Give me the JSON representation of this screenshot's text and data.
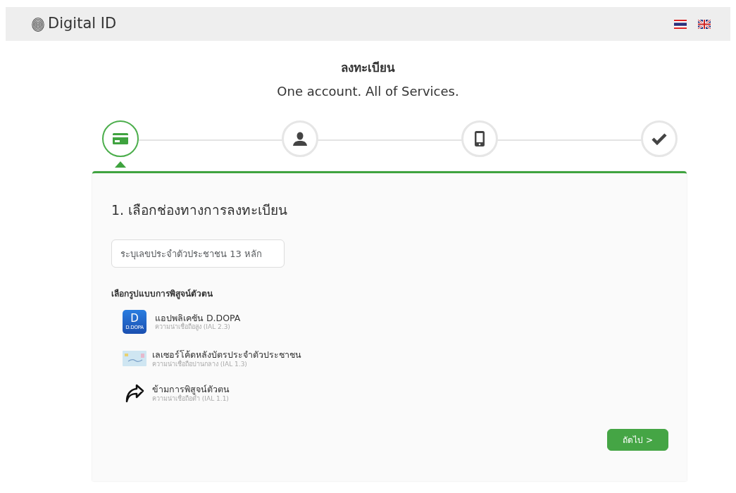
{
  "header": {
    "brand": "Digital ID",
    "languages": [
      {
        "kind": "thai"
      },
      {
        "kind": "english"
      }
    ]
  },
  "title": "ลงทะเบียน",
  "subtitle": "One account. All of Services.",
  "steps": [
    {
      "kind": "card",
      "selected": true
    },
    {
      "kind": "person",
      "selected": false
    },
    {
      "kind": "phone",
      "selected": false
    },
    {
      "kind": "check",
      "selected": false
    }
  ],
  "form": {
    "heading": "1. เลือกช่องทางการลงทะเบียน",
    "id_field": {
      "placeholder": "ระบุเลขประจำตัวประชาชน 13 หลัก"
    },
    "method_label": "เลือกรูปแบบการพิสูจน์ตัวตน",
    "methods": [
      {
        "kind": "app",
        "title": "แอปพลิเคชัน D.DOPA",
        "subtitle": "ความน่าเชื่อถือสูง (IAL 2.3)",
        "icon_letter": "D",
        "icon_caption": "D.DOPA"
      },
      {
        "kind": "idcard",
        "title": "เลเซอร์โค้ดหลังบัตรประจำตัวประชาชน",
        "subtitle": "ความน่าเชื่อถือปานกลาง (IAL 1.3)"
      },
      {
        "kind": "skip",
        "title": "ข้ามการพิสูจน์ตัวตน",
        "subtitle": "ความน่าเชื่อถือต่ำ (IAL 1.1)"
      }
    ],
    "next_button": "ถัดไป >"
  }
}
